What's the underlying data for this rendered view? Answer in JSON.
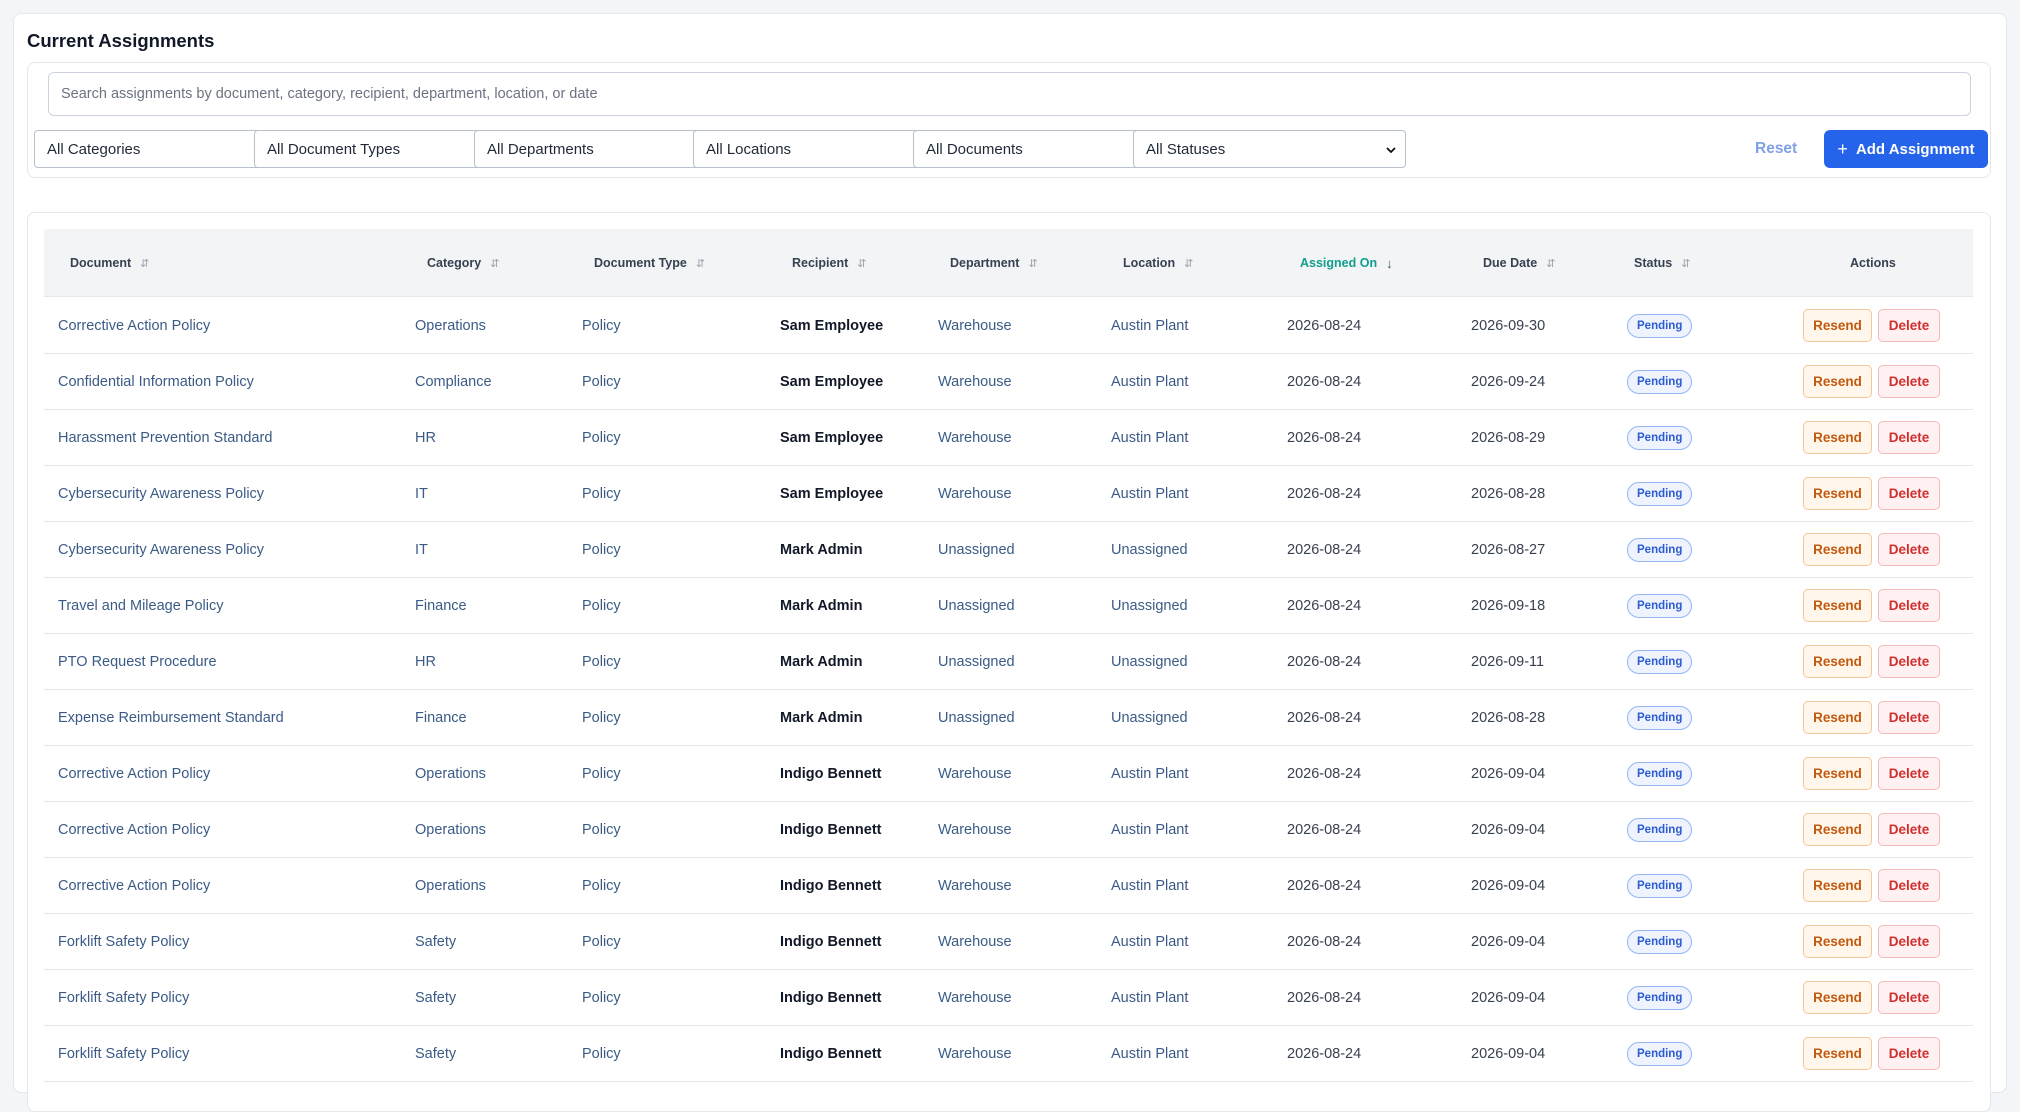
{
  "page": {
    "title": "Current Assignments"
  },
  "search": {
    "placeholder": "Search assignments by document, category, recipient, department, location, or date",
    "value": ""
  },
  "filters": [
    {
      "label": "All Categories"
    },
    {
      "label": "All Document Types"
    },
    {
      "label": "All Departments"
    },
    {
      "label": "All Locations"
    },
    {
      "label": "All Documents"
    },
    {
      "label": "All Statuses"
    }
  ],
  "actions": {
    "reset_label": "Reset",
    "add_label": "Add Assignment",
    "add_icon": "plus-icon"
  },
  "colors": {
    "accent": "#2563eb",
    "sorted_column": "#0f9f8c",
    "resend": "#c2590c",
    "delete": "#d12e2e",
    "pending": "#2d5bd2"
  },
  "table": {
    "sorted_by": "Assigned On",
    "sort_direction": "descending",
    "columns": [
      "Document",
      "Category",
      "Document Type",
      "Recipient",
      "Department",
      "Location",
      "Assigned On",
      "Due Date",
      "Status",
      "Actions"
    ],
    "row_actions": {
      "resend": "Resend",
      "delete": "Delete"
    },
    "rows": [
      {
        "document": "Corrective Action Policy",
        "category": "Operations",
        "type": "Policy",
        "recipient": "Sam Employee",
        "department": "Warehouse",
        "location": "Austin Plant",
        "assigned": "2026-08-24",
        "due": "2026-09-30",
        "status": "Pending"
      },
      {
        "document": "Confidential Information Policy",
        "category": "Compliance",
        "type": "Policy",
        "recipient": "Sam Employee",
        "department": "Warehouse",
        "location": "Austin Plant",
        "assigned": "2026-08-24",
        "due": "2026-09-24",
        "status": "Pending"
      },
      {
        "document": "Harassment Prevention Standard",
        "category": "HR",
        "type": "Policy",
        "recipient": "Sam Employee",
        "department": "Warehouse",
        "location": "Austin Plant",
        "assigned": "2026-08-24",
        "due": "2026-08-29",
        "status": "Pending"
      },
      {
        "document": "Cybersecurity Awareness Policy",
        "category": "IT",
        "type": "Policy",
        "recipient": "Sam Employee",
        "department": "Warehouse",
        "location": "Austin Plant",
        "assigned": "2026-08-24",
        "due": "2026-08-28",
        "status": "Pending"
      },
      {
        "document": "Cybersecurity Awareness Policy",
        "category": "IT",
        "type": "Policy",
        "recipient": "Mark Admin",
        "department": "Unassigned",
        "location": "Unassigned",
        "assigned": "2026-08-24",
        "due": "2026-08-27",
        "status": "Pending"
      },
      {
        "document": "Travel and Mileage Policy",
        "category": "Finance",
        "type": "Policy",
        "recipient": "Mark Admin",
        "department": "Unassigned",
        "location": "Unassigned",
        "assigned": "2026-08-24",
        "due": "2026-09-18",
        "status": "Pending"
      },
      {
        "document": "PTO Request Procedure",
        "category": "HR",
        "type": "Policy",
        "recipient": "Mark Admin",
        "department": "Unassigned",
        "location": "Unassigned",
        "assigned": "2026-08-24",
        "due": "2026-09-11",
        "status": "Pending"
      },
      {
        "document": "Expense Reimbursement Standard",
        "category": "Finance",
        "type": "Policy",
        "recipient": "Mark Admin",
        "department": "Unassigned",
        "location": "Unassigned",
        "assigned": "2026-08-24",
        "due": "2026-08-28",
        "status": "Pending"
      },
      {
        "document": "Corrective Action Policy",
        "category": "Operations",
        "type": "Policy",
        "recipient": "Indigo Bennett",
        "department": "Warehouse",
        "location": "Austin Plant",
        "assigned": "2026-08-24",
        "due": "2026-09-04",
        "status": "Pending"
      },
      {
        "document": "Corrective Action Policy",
        "category": "Operations",
        "type": "Policy",
        "recipient": "Indigo Bennett",
        "department": "Warehouse",
        "location": "Austin Plant",
        "assigned": "2026-08-24",
        "due": "2026-09-04",
        "status": "Pending"
      },
      {
        "document": "Corrective Action Policy",
        "category": "Operations",
        "type": "Policy",
        "recipient": "Indigo Bennett",
        "department": "Warehouse",
        "location": "Austin Plant",
        "assigned": "2026-08-24",
        "due": "2026-09-04",
        "status": "Pending"
      },
      {
        "document": "Forklift Safety Policy",
        "category": "Safety",
        "type": "Policy",
        "recipient": "Indigo Bennett",
        "department": "Warehouse",
        "location": "Austin Plant",
        "assigned": "2026-08-24",
        "due": "2026-09-04",
        "status": "Pending"
      },
      {
        "document": "Forklift Safety Policy",
        "category": "Safety",
        "type": "Policy",
        "recipient": "Indigo Bennett",
        "department": "Warehouse",
        "location": "Austin Plant",
        "assigned": "2026-08-24",
        "due": "2026-09-04",
        "status": "Pending"
      },
      {
        "document": "Forklift Safety Policy",
        "category": "Safety",
        "type": "Policy",
        "recipient": "Indigo Bennett",
        "department": "Warehouse",
        "location": "Austin Plant",
        "assigned": "2026-08-24",
        "due": "2026-09-04",
        "status": "Pending"
      }
    ]
  }
}
